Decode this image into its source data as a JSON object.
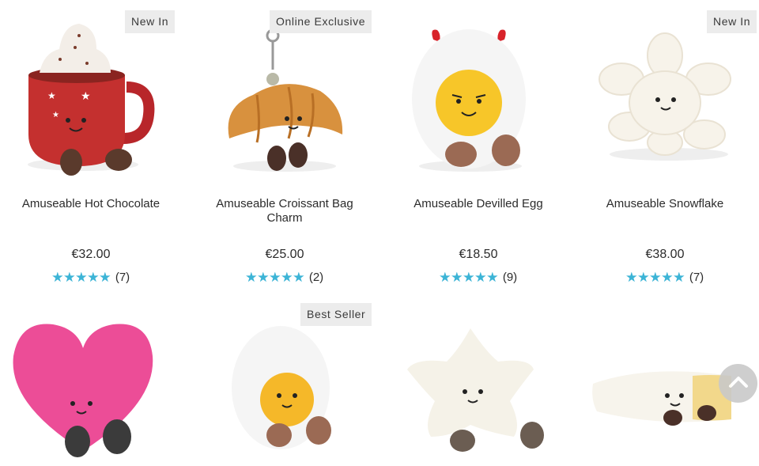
{
  "products": [
    {
      "name": "Amuseable Hot Chocolate",
      "price": "€32.00",
      "reviews": "(7)",
      "badge": "New In",
      "rating": 5
    },
    {
      "name": "Amuseable Croissant Bag Charm",
      "price": "€25.00",
      "reviews": "(2)",
      "badge": "Online Exclusive",
      "rating": 5
    },
    {
      "name": "Amuseable Devilled Egg",
      "price": "€18.50",
      "reviews": "(9)",
      "badge": "",
      "rating": 5
    },
    {
      "name": "Amuseable Snowflake",
      "price": "€38.00",
      "reviews": "(7)",
      "badge": "New In",
      "rating": 5
    },
    {
      "badge": "",
      "icon": "pink-heart-plush-image"
    },
    {
      "badge": "Best Seller",
      "icon": "boiled-egg-plush-image"
    },
    {
      "badge": "",
      "icon": "star-plush-image"
    },
    {
      "badge": "",
      "icon": "brie-cheese-plush-image"
    }
  ],
  "colors": {
    "star": "#3cb4d6",
    "badge_bg": "#ececec"
  },
  "icons": {
    "scroll_top": "chevron-up-icon"
  }
}
